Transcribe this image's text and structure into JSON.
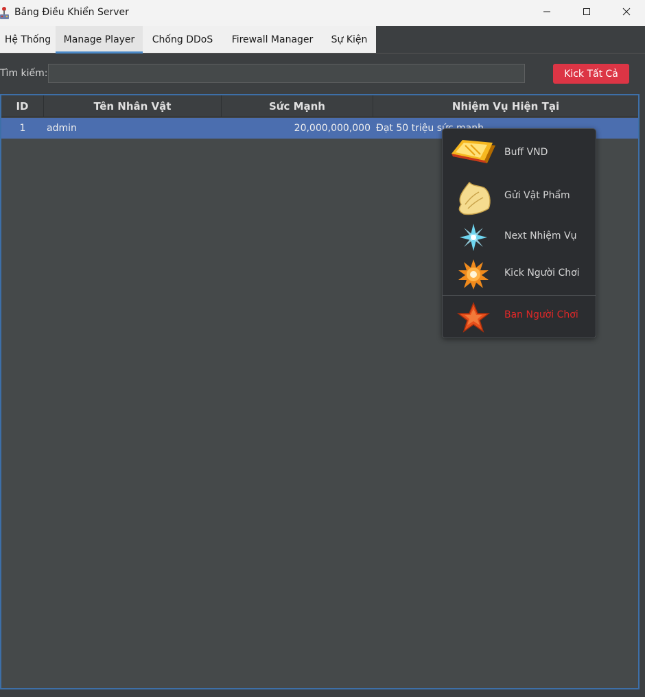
{
  "window": {
    "title": "Bảng Điều Khiển Server",
    "controls": [
      "minimize-icon",
      "maximize-icon",
      "close-icon"
    ]
  },
  "tabs": [
    {
      "label": "Hệ Thống",
      "active": false
    },
    {
      "label": "Manage Player",
      "active": true
    },
    {
      "label": "Chống DDoS",
      "active": false
    },
    {
      "label": "Firewall Manager",
      "active": false
    },
    {
      "label": "Sự Kiện",
      "active": false
    }
  ],
  "search": {
    "label": "Tìm kiếm:",
    "value": "",
    "placeholder": ""
  },
  "kick_all_label": "Kick Tất Cả",
  "table": {
    "columns": [
      "ID",
      "Tên Nhân Vật",
      "Sức Mạnh",
      "Nhiệm Vụ Hiện Tại"
    ],
    "rows": [
      {
        "id": "1",
        "name": "admin",
        "power": "20,000,000,000",
        "quest": "Đạt 50 triệu sức mạnh",
        "selected": true
      }
    ]
  },
  "context_menu": {
    "items": [
      {
        "label": "Buff VND",
        "icon": "gold-bar-icon"
      },
      {
        "label": "Gửi Vật Phẩm",
        "icon": "scroll-icon"
      },
      {
        "label": "Next Nhiệm Vụ",
        "icon": "sparkle-icon"
      },
      {
        "label": "Kick Người Chơi",
        "icon": "burst-icon"
      },
      {
        "label": "Ban Người Chơi",
        "icon": "star-icon",
        "danger": true
      }
    ]
  },
  "colors": {
    "accent": "#4a88c7",
    "selection": "#4b6eaf",
    "danger_button": "#dc3545",
    "danger_text": "#e02828",
    "table_border": "#3d6fa8"
  }
}
